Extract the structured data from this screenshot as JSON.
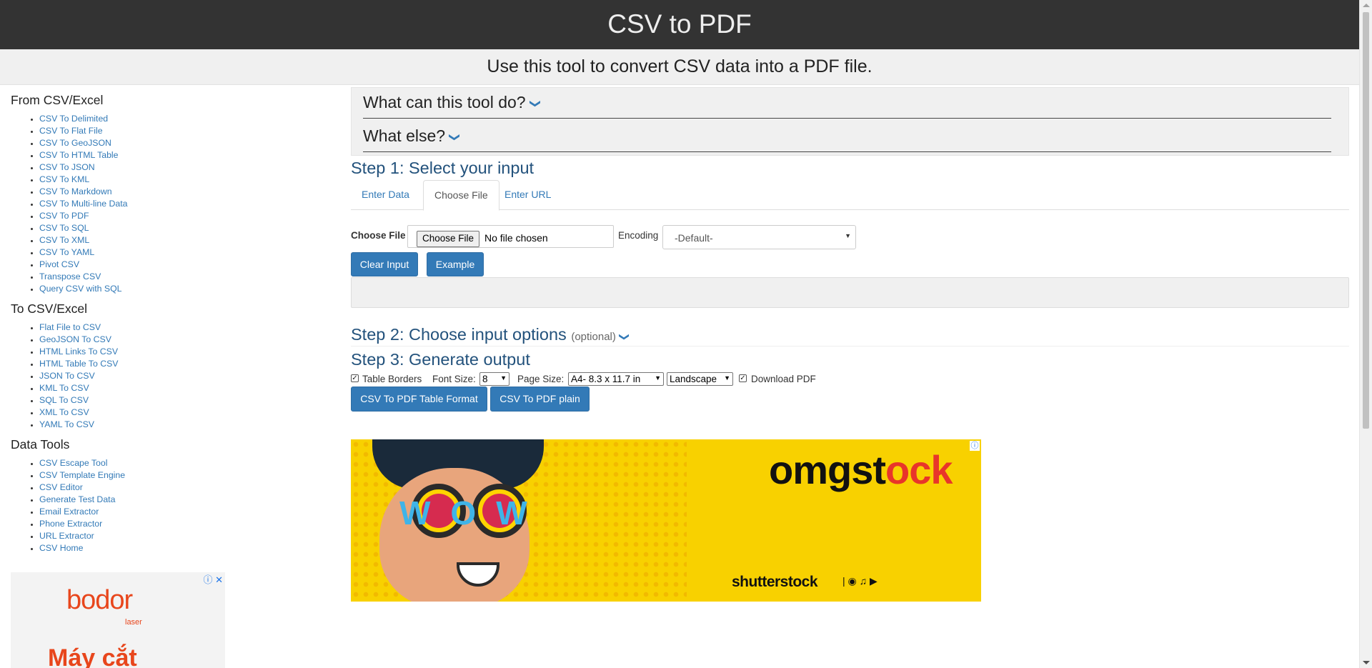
{
  "header": {
    "title": "CSV to PDF",
    "subtitle": "Use this tool to convert CSV data into a PDF file."
  },
  "sidebar": {
    "sections": [
      {
        "title": "From CSV/Excel",
        "links": [
          "CSV To Delimited",
          "CSV To Flat File",
          "CSV To GeoJSON",
          "CSV To HTML Table",
          "CSV To JSON",
          "CSV To KML",
          "CSV To Markdown",
          "CSV To Multi-line Data",
          "CSV To PDF",
          "CSV To SQL",
          "CSV To XML",
          "CSV To YAML",
          "Pivot CSV",
          "Transpose CSV",
          "Query CSV with SQL"
        ]
      },
      {
        "title": "To CSV/Excel",
        "links": [
          "Flat File to CSV",
          "GeoJSON To CSV",
          "HTML Links To CSV",
          "HTML Table To CSV",
          "JSON To CSV",
          "KML To CSV",
          "SQL To CSV",
          "XML To CSV",
          "YAML To CSV"
        ]
      },
      {
        "title": "Data Tools",
        "links": [
          "CSV Escape Tool",
          "CSV Template Engine",
          "CSV Editor",
          "Generate Test Data",
          "Email Extractor",
          "Phone Extractor",
          "URL Extractor",
          "CSV Home"
        ]
      }
    ],
    "ad": {
      "logo": "bodor",
      "logo_sub": "laser",
      "headline": "Máy cắt"
    }
  },
  "main": {
    "accordion": [
      {
        "label": "What can this tool do?",
        "icon": "chevron-down-icon"
      },
      {
        "label": "What else?",
        "icon": "chevron-down-icon"
      }
    ],
    "step1": {
      "title": "Step 1: Select your input",
      "tabs": [
        "Enter Data",
        "Choose File",
        "Enter URL"
      ],
      "active_tab": "Choose File",
      "choose_file_label": "Choose File",
      "choose_file_button": "Choose File",
      "no_file_text": "No file chosen",
      "encoding_label": "Encoding",
      "encoding_value": "-Default-",
      "clear_button": "Clear Input",
      "example_button": "Example"
    },
    "step2": {
      "title": "Step 2: Choose input options",
      "optional": "(optional)"
    },
    "step3": {
      "title": "Step 3: Generate output",
      "table_borders_label": "Table Borders",
      "table_borders_checked": true,
      "font_size_label": "Font Size:",
      "font_size_value": "8",
      "page_size_label": "Page Size:",
      "page_size_value": "A4- 8.3 x 11.7 in",
      "orientation_value": "Landscape",
      "download_pdf_label": "Download PDF",
      "download_pdf_checked": true,
      "table_format_button": "CSV To PDF Table Format",
      "plain_button": "CSV To PDF plain"
    }
  },
  "ad_main": {
    "brand_black": "omgst",
    "brand_red": "ck",
    "brand_mid": "o",
    "wow": "WOW",
    "footer_brand": "shutterstock",
    "footer_icons": "| ◉ ♫ ▶"
  },
  "colors": {
    "header_bg": "#333333",
    "link": "#337ab7",
    "button": "#337ab7",
    "ad_yellow": "#f8d100"
  }
}
